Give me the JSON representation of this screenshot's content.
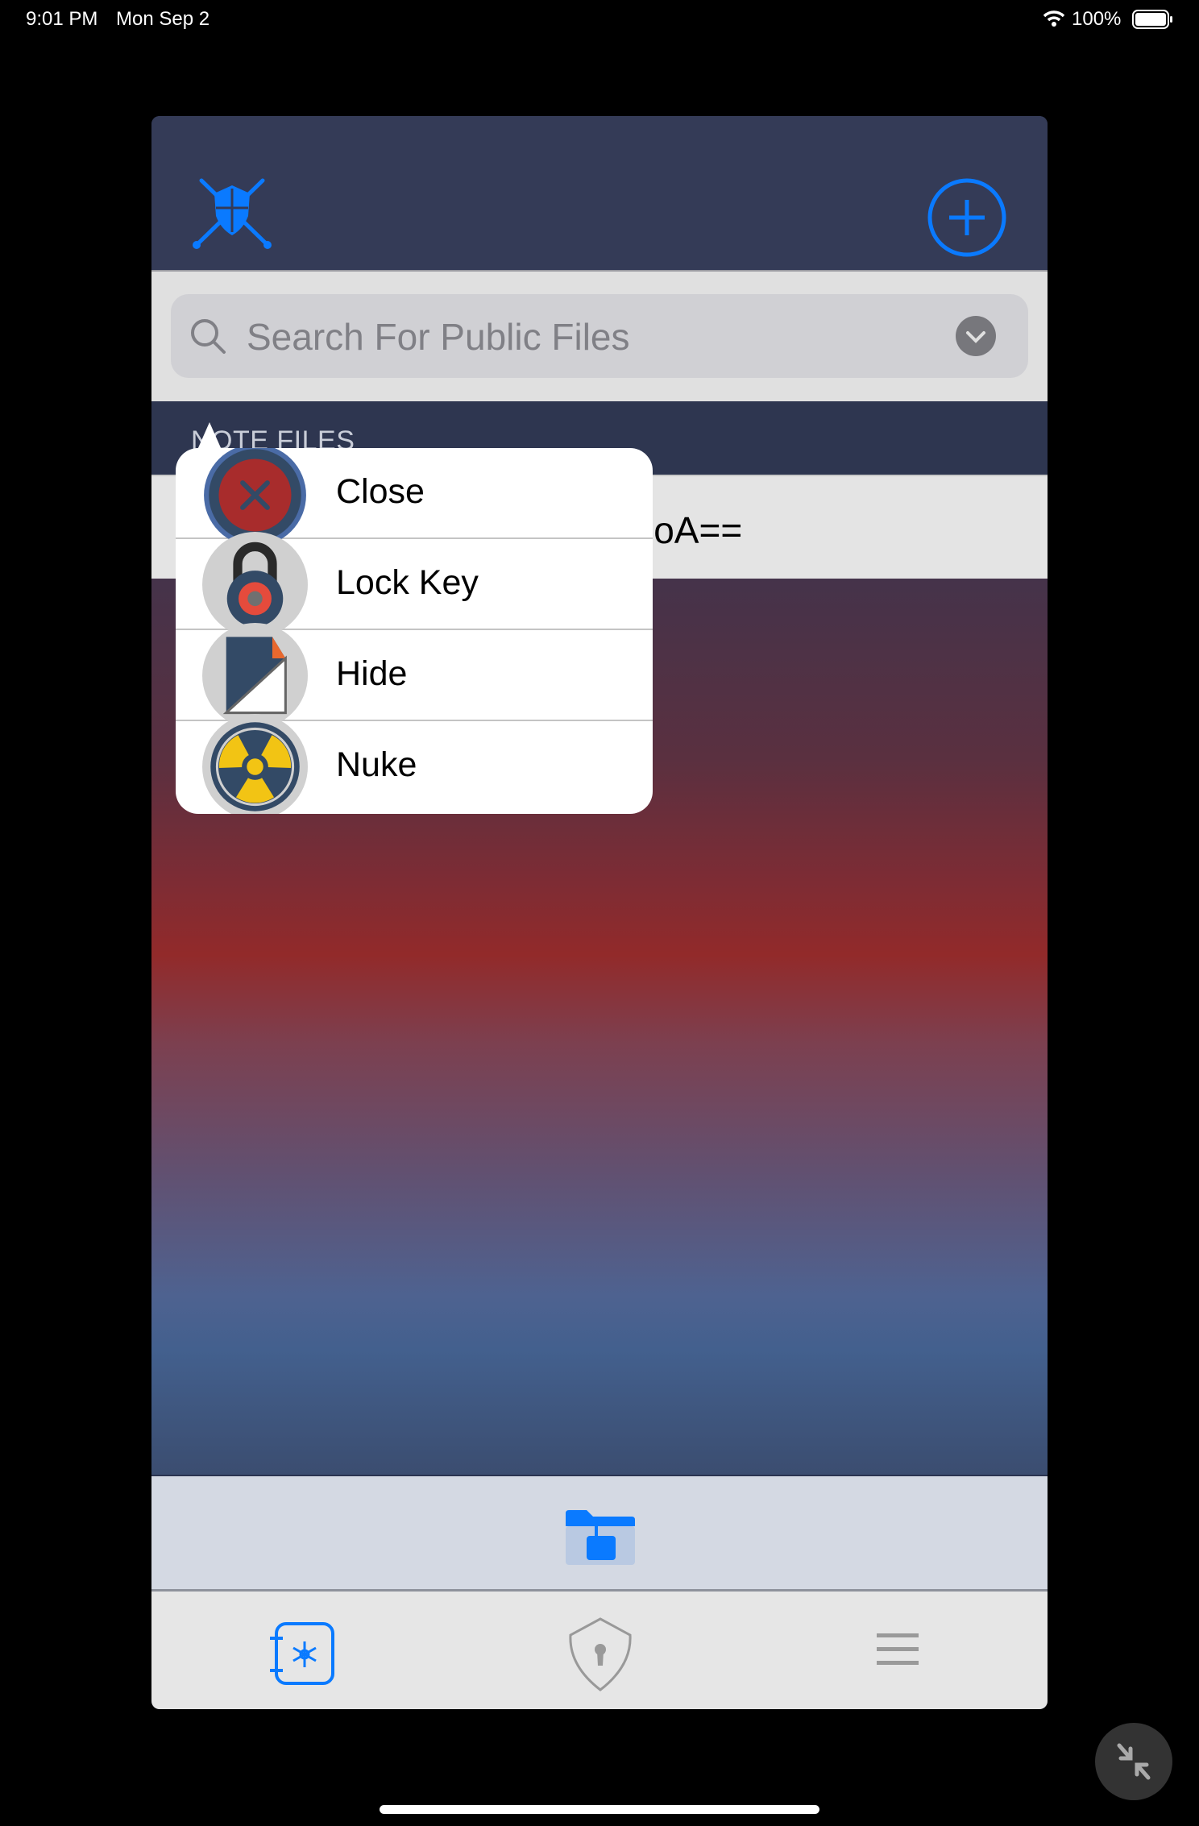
{
  "status_bar": {
    "time": "9:01 PM",
    "date": "Mon Sep 2",
    "battery": "100%"
  },
  "header": {
    "logo_icon": "shield-crossed-swords-icon",
    "add_icon": "plus-circle-icon"
  },
  "search": {
    "placeholder": "Search For Public Files",
    "dropdown_icon": "chevron-down-icon"
  },
  "section": {
    "label": "NOTE FILES"
  },
  "file_row": {
    "visible_text": "DoA=="
  },
  "popup_menu": {
    "items": [
      {
        "label": "Close",
        "icon": "close-icon"
      },
      {
        "label": "Lock Key",
        "icon": "padlock-icon"
      },
      {
        "label": "Hide",
        "icon": "hide-file-icon"
      },
      {
        "label": "Nuke",
        "icon": "radiation-icon"
      }
    ]
  },
  "toolbar": {
    "icon": "locked-folder-icon"
  },
  "tab_bar": {
    "tabs": [
      {
        "icon": "vault-icon",
        "active": true
      },
      {
        "icon": "shield-keyhole-icon",
        "active": false
      },
      {
        "icon": "menu-icon",
        "active": false
      }
    ]
  },
  "colors": {
    "accent": "#0a7aff",
    "header": "#343b57",
    "section": "#2e3650",
    "danger": "#a82c2c"
  }
}
